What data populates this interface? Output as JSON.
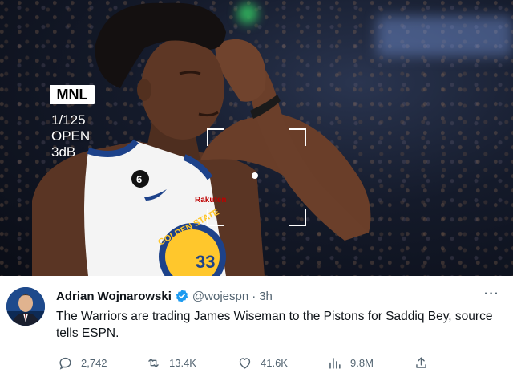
{
  "media": {
    "camera_mode": "MNL",
    "shutter": "1/125",
    "aperture": "OPEN",
    "gain": "3dB",
    "jersey_number": "6",
    "jersey_text": "GOLDEN STATE",
    "jersey_big_number": "33",
    "sponsor": "Rakuten"
  },
  "tweet": {
    "author_name": "Adrian Wojnarowski",
    "handle": "@wojespn",
    "separator": "·",
    "time": "3h",
    "more": "···",
    "text": "The Warriors are trading James Wiseman to the Pistons for Saddiq Bey, source tells ESPN.",
    "replies": "2,742",
    "retweets": "13.4K",
    "likes": "41.6K",
    "views": "9.8M"
  },
  "colors": {
    "verified": "#1d9bf0",
    "muted": "#536471",
    "jersey_blue": "#1d428a",
    "jersey_gold": "#ffc72c"
  },
  "icons": [
    "verified-badge-icon",
    "more-icon",
    "reply-icon",
    "retweet-icon",
    "like-icon",
    "views-icon",
    "share-icon"
  ]
}
